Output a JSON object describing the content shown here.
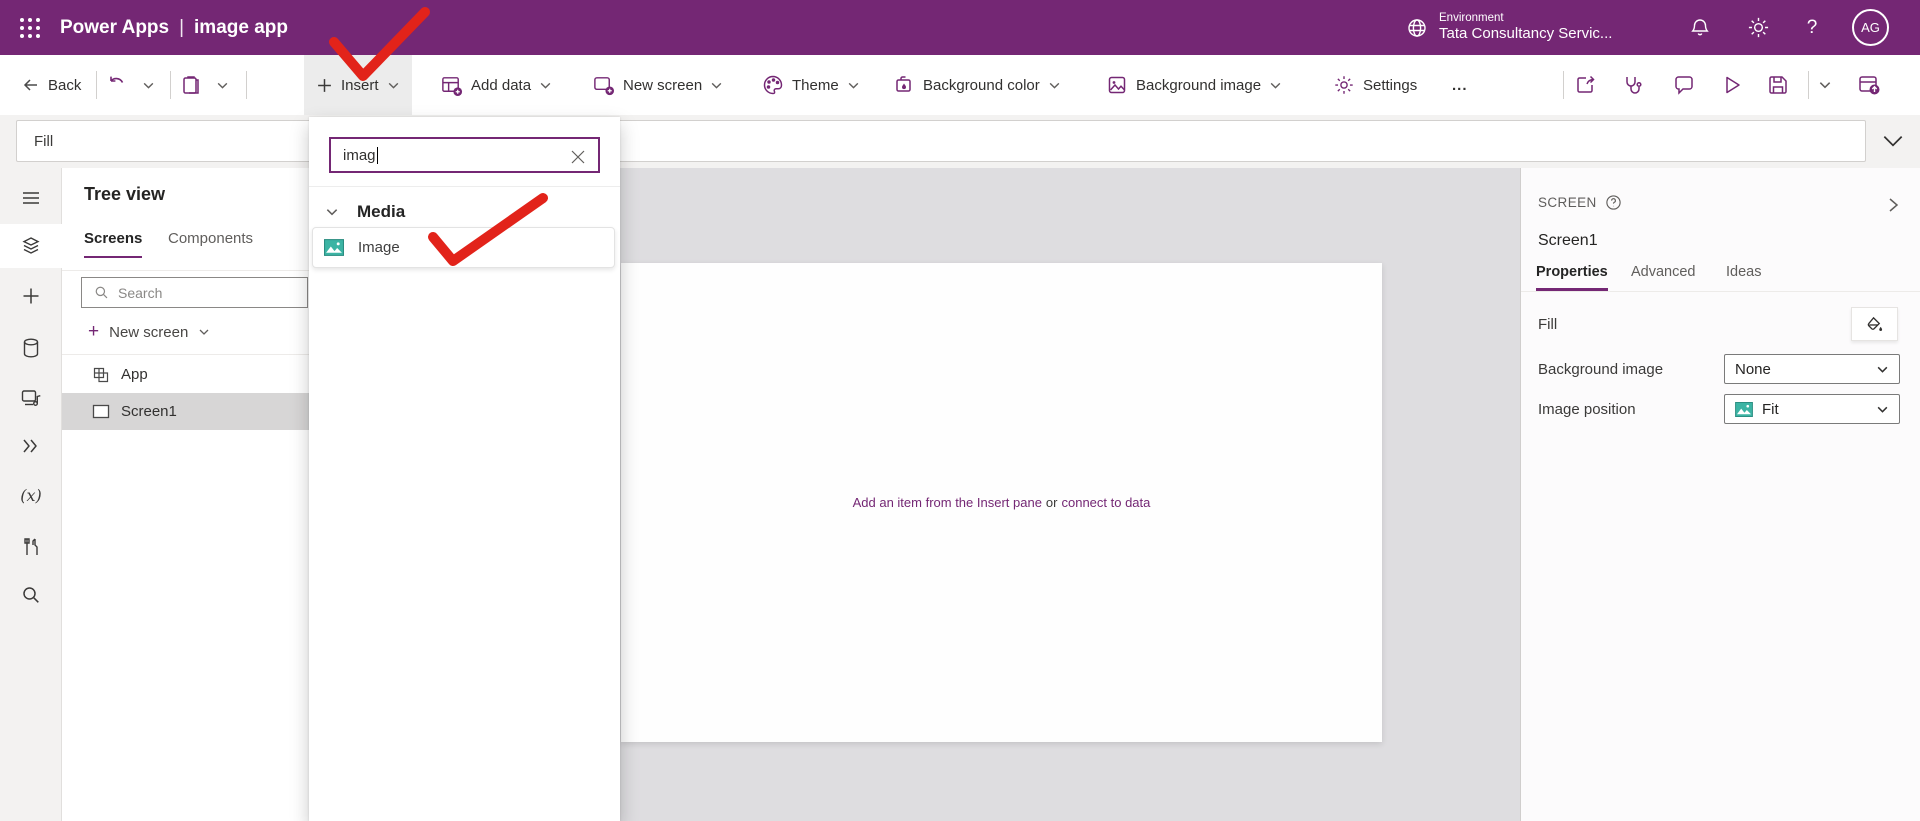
{
  "header": {
    "product": "Power Apps",
    "separator": "|",
    "app_title": "image app",
    "environment_label": "Environment",
    "environment_name": "Tata Consultancy Servic...",
    "avatar_initials": "AG"
  },
  "toolbar": {
    "back": "Back",
    "insert": "Insert",
    "add_data": "Add data",
    "new_screen": "New screen",
    "theme": "Theme",
    "background_color": "Background color",
    "background_image": "Background image",
    "settings": "Settings",
    "more_glyph": "..."
  },
  "formula_bar": {
    "property_value": "Fill"
  },
  "tree_panel": {
    "title": "Tree view",
    "tabs": [
      "Screens",
      "Components"
    ],
    "search_placeholder": "Search",
    "new_screen": "New screen",
    "item_app": "App",
    "item_screen1": "Screen1"
  },
  "insert_flyout": {
    "search_value": "imag",
    "media_section": "Media",
    "image_item": "Image"
  },
  "canvas": {
    "empty_part1": "Add an item from the Insert pane",
    "empty_or": "or",
    "empty_part2": "connect to data"
  },
  "properties_panel": {
    "type_label": "SCREEN",
    "screen_name": "Screen1",
    "tabs": [
      "Properties",
      "Advanced",
      "Ideas"
    ],
    "fill_label": "Fill",
    "background_image_label": "Background image",
    "background_image_value": "None",
    "image_position_label": "Image position",
    "image_position_value": "Fit"
  },
  "icons": {
    "help_glyph": "?",
    "variables_glyph": "(x)"
  },
  "colors": {
    "brand_purple": "#742774",
    "annotation_red": "#e2231a",
    "teal_icon": "#3cb4a4",
    "canvas_bg": "#dedde0",
    "selected_row": "#d7d6d6"
  }
}
